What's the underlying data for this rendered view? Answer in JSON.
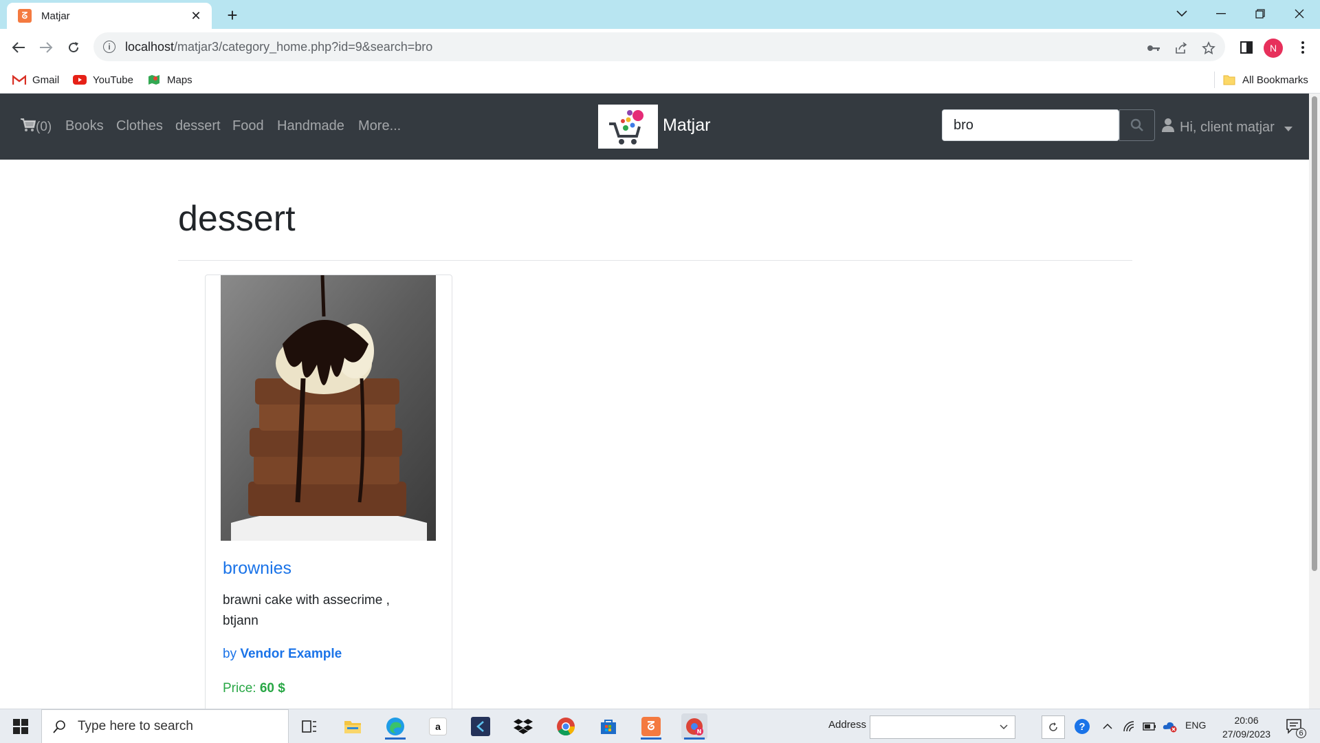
{
  "browser": {
    "tab_title": "Matjar",
    "url_host": "localhost",
    "url_path": "/matjar3/category_home.php?id=9&search=bro",
    "profile_initial": "N",
    "bookmarks": [
      {
        "label": "Gmail"
      },
      {
        "label": "YouTube"
      },
      {
        "label": "Maps"
      }
    ],
    "all_bookmarks_label": "All Bookmarks"
  },
  "navbar": {
    "cart_label": "(0)",
    "links": [
      "Books",
      "Clothes",
      "dessert",
      "Food",
      "Handmade",
      "More..."
    ],
    "brand": "Matjar",
    "search_value": "bro",
    "user_label": "Hi, client matjar"
  },
  "page": {
    "heading": "dessert",
    "products": [
      {
        "title": "brownies",
        "description": "brawni cake with assecrime , btjann",
        "by_label": "by",
        "vendor": "Vendor Example",
        "price_label": "Price:",
        "price": "60 $"
      }
    ]
  },
  "taskbar": {
    "search_placeholder": "Type here to search",
    "address_label": "Address",
    "language": "ENG",
    "time": "20:06",
    "date": "27/09/2023",
    "notification_count": "6"
  },
  "colors": {
    "tab_strip": "#b8e5f1",
    "navbar_bg": "#343a40",
    "link_blue": "#1a73e8",
    "price_green": "#28a745",
    "profile_pink": "#e7305b"
  }
}
